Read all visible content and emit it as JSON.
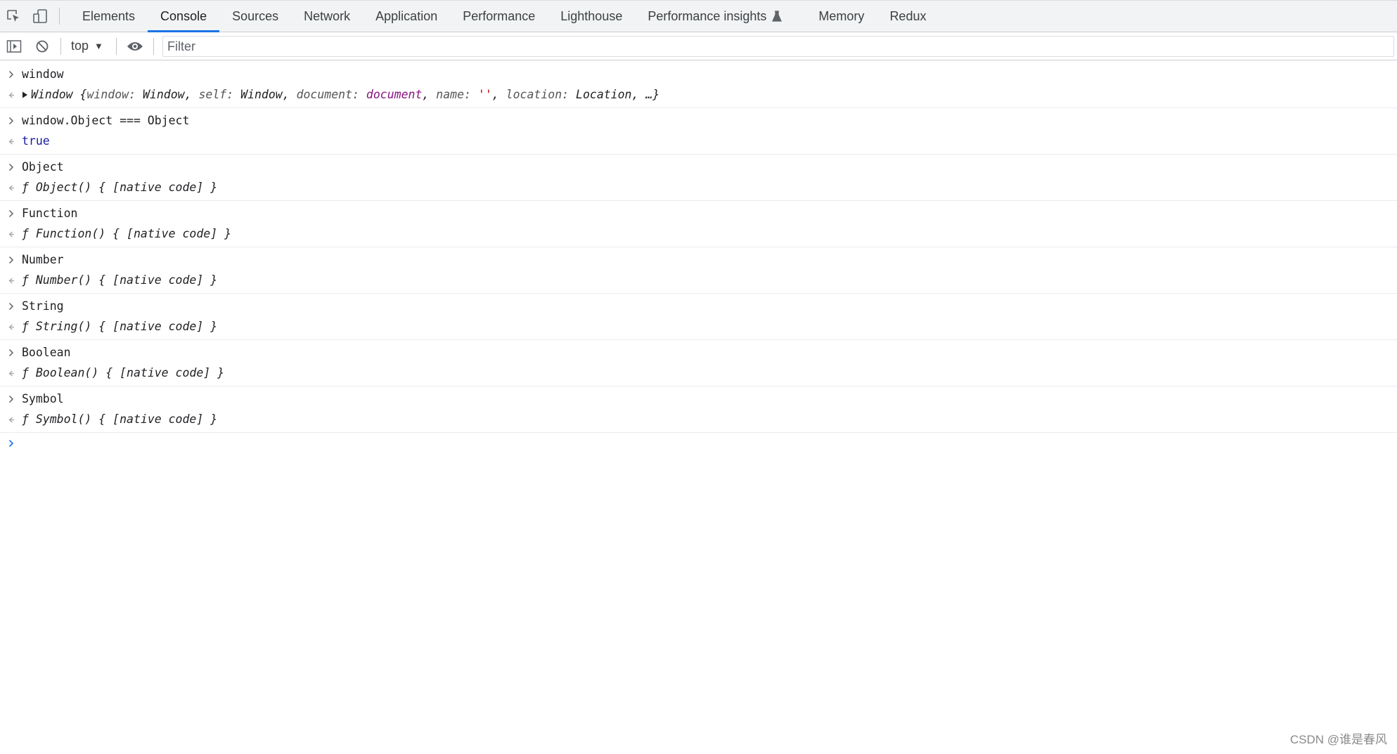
{
  "tabbar": {
    "tabs": [
      {
        "label": "Elements"
      },
      {
        "label": "Console"
      },
      {
        "label": "Sources"
      },
      {
        "label": "Network"
      },
      {
        "label": "Application"
      },
      {
        "label": "Performance"
      },
      {
        "label": "Lighthouse"
      },
      {
        "label": "Performance insights"
      },
      {
        "label": "Memory"
      },
      {
        "label": "Redux"
      }
    ],
    "active_tab": "Console",
    "icons": [
      "inspect-element-icon",
      "device-toolbar-icon",
      "flask-icon"
    ]
  },
  "toolbar": {
    "context": "top",
    "filter_placeholder": "Filter",
    "icons": [
      "sidebar-toggle-icon",
      "clear-console-icon",
      "live-expression-eye-icon",
      "dropdown-caret-icon"
    ]
  },
  "console": {
    "entries": [
      {
        "input": "window",
        "output_parts": {
          "open": "Window {",
          "k1": "window",
          "v1": "Window",
          "k2": "self",
          "v2": "Window",
          "k3": "document",
          "v3": "document",
          "k4": "name",
          "v4": "''",
          "k5": "location",
          "v5": "Location",
          "tail": ", …}"
        }
      },
      {
        "input": "window.Object === Object",
        "output": "true"
      },
      {
        "input": "Object",
        "output": "Object() { [native code] }"
      },
      {
        "input": "Function",
        "output": "Function() { [native code] }"
      },
      {
        "input": "Number",
        "output": "Number() { [native code] }"
      },
      {
        "input": "String",
        "output": "String() { [native code] }"
      },
      {
        "input": "Boolean",
        "output": "Boolean() { [native code] }"
      },
      {
        "input": "Symbol",
        "output": "Symbol() { [native code] }"
      }
    ],
    "function_glyph": "ƒ"
  },
  "watermark": "CSDN @谁是春风",
  "colors": {
    "accent": "#1a73e8",
    "true_value": "#1a1aa6",
    "dom_node": "#881280",
    "string": "#c80000"
  }
}
